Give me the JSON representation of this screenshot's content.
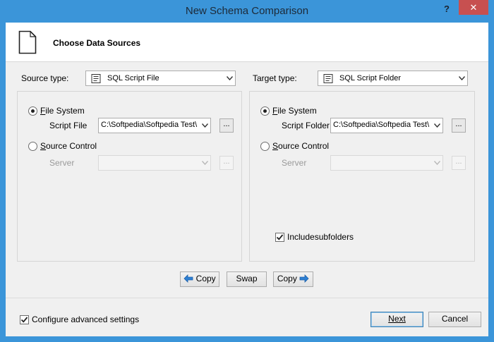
{
  "window": {
    "title": "New Schema Comparison",
    "help_glyph": "?",
    "close_glyph": "✕"
  },
  "header": {
    "title": "Choose Data Sources"
  },
  "source": {
    "type_label": "Source type:",
    "type_value": "SQL Script File",
    "filesystem_label": "File System",
    "script_file_label": "Script File",
    "script_file_value": "C:\\Softpedia\\Softpedia Test\\",
    "source_control_label": "Source Control",
    "server_label": "Server",
    "browse_label": "..."
  },
  "target": {
    "type_label": "Target type:",
    "type_value": "SQL Script Folder",
    "filesystem_label": "File System",
    "script_folder_label": "Script Folder",
    "script_folder_value": "C:\\Softpedia\\Softpedia Test\\",
    "source_control_label": "Source Control",
    "server_label": "Server",
    "browse_label": "...",
    "include_subfolders_label": "Includesubfolders"
  },
  "actions": {
    "copy_left": "Copy",
    "swap": "Swap",
    "copy_right": "Copy"
  },
  "footer": {
    "advanced_label": "Configure advanced settings",
    "next_label": "Next",
    "cancel_label": "Cancel"
  },
  "colors": {
    "titlebar": "#3b95d9",
    "close_button": "#c75050",
    "default_button_border": "#3c7fb1",
    "arrow_blue": "#2d7fd3"
  },
  "icons": {
    "page": "document-icon",
    "script": "script-file-icon",
    "dropdown": "chevron-down-icon",
    "copy_left": "arrow-left-icon",
    "copy_right": "arrow-right-icon",
    "check": "checkmark-icon"
  }
}
